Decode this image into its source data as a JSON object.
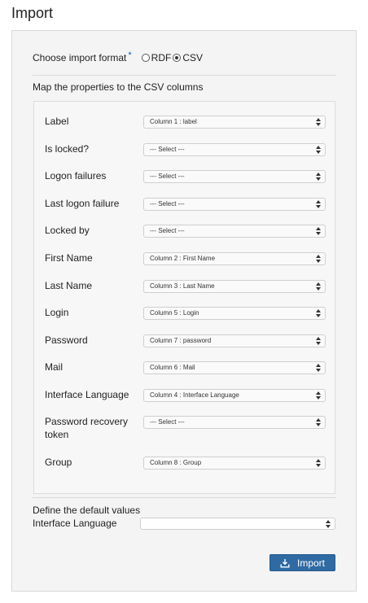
{
  "page": {
    "title": "Import"
  },
  "format": {
    "label": "Choose import format",
    "required_mark": "*",
    "options": [
      {
        "label": "RDF",
        "checked": false
      },
      {
        "label": "CSV",
        "checked": true
      }
    ]
  },
  "mapping": {
    "title": "Map the properties to the CSV columns",
    "rows": [
      {
        "label": "Label",
        "value": "Column 1 : label"
      },
      {
        "label": "Is locked?",
        "value": "--- Select ---"
      },
      {
        "label": "Logon failures",
        "value": "--- Select ---"
      },
      {
        "label": "Last logon failure",
        "value": "--- Select ---"
      },
      {
        "label": "Locked by",
        "value": "--- Select ---"
      },
      {
        "label": "First Name",
        "value": "Column 2 : First Name"
      },
      {
        "label": "Last Name",
        "value": "Column 3 : Last Name"
      },
      {
        "label": "Login",
        "value": "Column 5 : Login"
      },
      {
        "label": "Password",
        "value": "Column 7 : password"
      },
      {
        "label": "Mail",
        "value": "Column 6 : Mail"
      },
      {
        "label": "Interface Language",
        "value": "Column 4 : Interface Language"
      },
      {
        "label": "Password recovery token",
        "value": "--- Select ---"
      },
      {
        "label": "Group",
        "value": "Column 8 : Group"
      }
    ]
  },
  "defaults": {
    "title": "Define the default values",
    "field_label": "Interface Language",
    "value": ""
  },
  "actions": {
    "import_label": "Import",
    "import_icon": "import-icon",
    "button_color": "#2f6aa3"
  }
}
